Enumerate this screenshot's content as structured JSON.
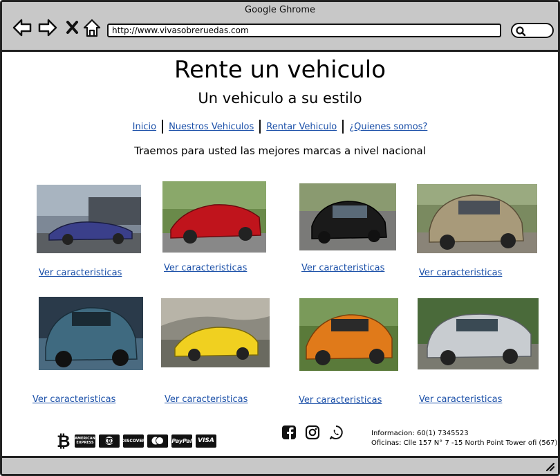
{
  "window": {
    "title": "Google Ghrome",
    "url": "http://www.vivasobreruedas.com"
  },
  "icons": [
    "back-arrow-icon",
    "forward-arrow-icon",
    "close-icon",
    "home-icon",
    "search-icon",
    "resize-grip-icon"
  ],
  "page": {
    "title": "Rente un vehiculo",
    "subtitle": "Un vehiculo a su estilo",
    "tagline": "Traemos para usted las mejores marcas a nivel nacional"
  },
  "nav": {
    "items": [
      {
        "label": "Inicio"
      },
      {
        "label": "Nuestros Vehiculos"
      },
      {
        "label": "Rentar Vehiculo"
      },
      {
        "label": "¿Quienes somos?"
      }
    ]
  },
  "cars": [
    {
      "link": "Ver caracteristicas",
      "color": "#3a3f8a",
      "bg": "#6b7a8c"
    },
    {
      "link": "Ver caracteristicas",
      "color": "#c0141c",
      "bg": "#5f7d3a"
    },
    {
      "link": "Ver caracteristicas",
      "color": "#1a1a1a",
      "bg": "#8a9a70"
    },
    {
      "link": "Ver caracteristicas",
      "color": "#a89a7a",
      "bg": "#7a8a60"
    },
    {
      "link": "Ver caracteristicas",
      "color": "#3f6a80",
      "bg": "#2a3a4a"
    },
    {
      "link": "Ver caracteristicas",
      "color": "#f0d020",
      "bg": "#8c8a80"
    },
    {
      "link": "Ver caracteristicas",
      "color": "#e07a1a",
      "bg": "#5a7a3a"
    },
    {
      "link": "Ver caracteristicas",
      "color": "#c8ccd0",
      "bg": "#4a6a3a"
    }
  ],
  "footer": {
    "payments": [
      "AMERICAN EXPRESS",
      "DINERS",
      "DISCOVER",
      "MasterCard",
      "PayPal",
      "VISA"
    ],
    "social": [
      "facebook-icon",
      "instagram-icon",
      "whatsapp-icon"
    ],
    "contact_line1": "Informacion: 60(1) 7345523",
    "contact_line2": "Oficinas: Clle 157 N° 7 -15 North Point Tower ofi (567)"
  }
}
